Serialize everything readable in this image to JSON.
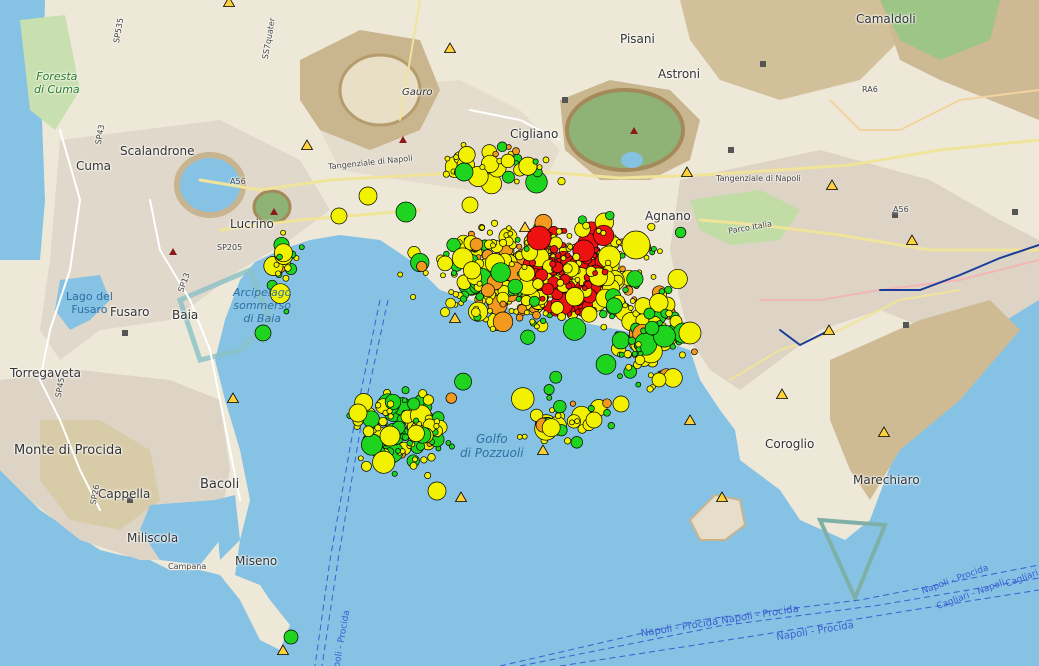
{
  "map": {
    "place_labels": [
      {
        "id": "camaldoli",
        "text": "Camaldoli"
      },
      {
        "id": "pisani",
        "text": "Pisani"
      },
      {
        "id": "astroni",
        "text": "Astroni"
      },
      {
        "id": "gauro",
        "text": "Gauro"
      },
      {
        "id": "scalandrone",
        "text": "Scalandrone"
      },
      {
        "id": "cuma",
        "text": "Cuma"
      },
      {
        "id": "lucrino",
        "text": "Lucrino"
      },
      {
        "id": "fusaro",
        "text": "Fusaro"
      },
      {
        "id": "baia",
        "text": "Baia"
      },
      {
        "id": "torregaveta",
        "text": "Torregaveta"
      },
      {
        "id": "monte-di-procida",
        "text": "Monte di Procida"
      },
      {
        "id": "bacoli",
        "text": "Bacoli"
      },
      {
        "id": "cappella",
        "text": "Cappella"
      },
      {
        "id": "miliscola",
        "text": "Miliscola"
      },
      {
        "id": "miseno",
        "text": "Miseno"
      },
      {
        "id": "coroglio",
        "text": "Coroglio"
      },
      {
        "id": "marechiaro",
        "text": "Marechiaro"
      },
      {
        "id": "cigliano",
        "text": "Cigliano"
      },
      {
        "id": "agnano",
        "text": "Agnano"
      }
    ],
    "nature_labels": [
      {
        "id": "foresta",
        "text": "Foresta\ndi Cuma"
      },
      {
        "id": "lago-fusaro",
        "text": "Lago del\nFusaro"
      },
      {
        "id": "arcipelago",
        "text": "Arcipelago\nsommerso\ndi Baia"
      },
      {
        "id": "golfo",
        "text": "Golfo\ndi Pozzuoli"
      }
    ],
    "road_labels": [
      {
        "id": "tangenziale-1",
        "text": "Tangenziale di Napoli"
      },
      {
        "id": "tangenziale-2",
        "text": "Tangenziale di Napoli"
      },
      {
        "id": "a56-1",
        "text": "A56"
      },
      {
        "id": "a56-2",
        "text": "A56"
      },
      {
        "id": "sp205",
        "text": "SP205"
      },
      {
        "id": "sp535",
        "text": "SP535"
      },
      {
        "id": "sp13",
        "text": "SP13"
      },
      {
        "id": "sp26",
        "text": "SP26"
      },
      {
        "id": "sp45",
        "text": "SP45"
      },
      {
        "id": "sp43",
        "text": "SP43"
      },
      {
        "id": "ss7",
        "text": "SS7quater"
      },
      {
        "id": "parco",
        "text": "Parco Italia"
      },
      {
        "id": "campana",
        "text": "Campana"
      },
      {
        "id": "ra6",
        "text": "RA6"
      }
    ],
    "ferry_labels": [
      {
        "id": "ferry-1",
        "text": "Napoli - Procida   Napoli - Procida"
      },
      {
        "id": "ferry-2",
        "text": "Napoli - Procida"
      },
      {
        "id": "ferry-3",
        "text": "Napoli - Procida"
      },
      {
        "id": "ferry-4",
        "text": "Cagliari - Napoli"
      },
      {
        "id": "ferry-5",
        "text": "Napoli - Procida"
      },
      {
        "id": "ferry-6",
        "text": "Cagliari"
      }
    ],
    "colors": {
      "sea": "#86c2e4",
      "land": "#eee8d8",
      "urban": "#ddd4c6",
      "hill": "#c9b58e",
      "crater": "#8aa86e",
      "forest": "#b5d29c",
      "ferry": "#3a5fd0"
    },
    "legend_colors": {
      "green": "#1ed41e",
      "yellow": "#f2f200",
      "orange": "#f39a1e",
      "red": "#ee1111"
    }
  }
}
